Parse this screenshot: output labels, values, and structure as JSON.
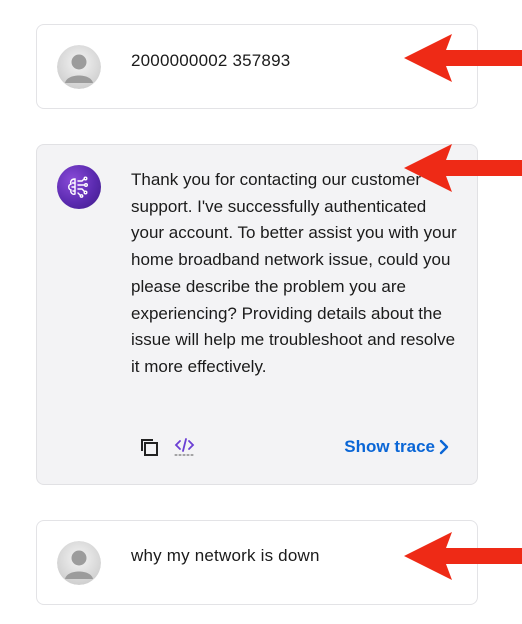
{
  "messages": [
    {
      "role": "user",
      "text": "2000000002 357893"
    },
    {
      "role": "assistant",
      "text": "Thank you for contacting our customer support. I've successfully authenticated your account. To better assist you with your home broadband network issue, could you please describe the problem you are experiencing? Providing details about the issue will help me troubleshoot and resolve it more effectively.",
      "actions": {
        "copy_icon": "copy-icon",
        "code_icon": "code-icon",
        "show_trace_label": "Show trace"
      }
    },
    {
      "role": "user",
      "text": "why my network is down"
    }
  ],
  "colors": {
    "arrow": "#ee2a16",
    "link": "#0a66d6",
    "bot_card_bg": "#f3f3f5",
    "bot_avatar": "#5b2bb0"
  }
}
